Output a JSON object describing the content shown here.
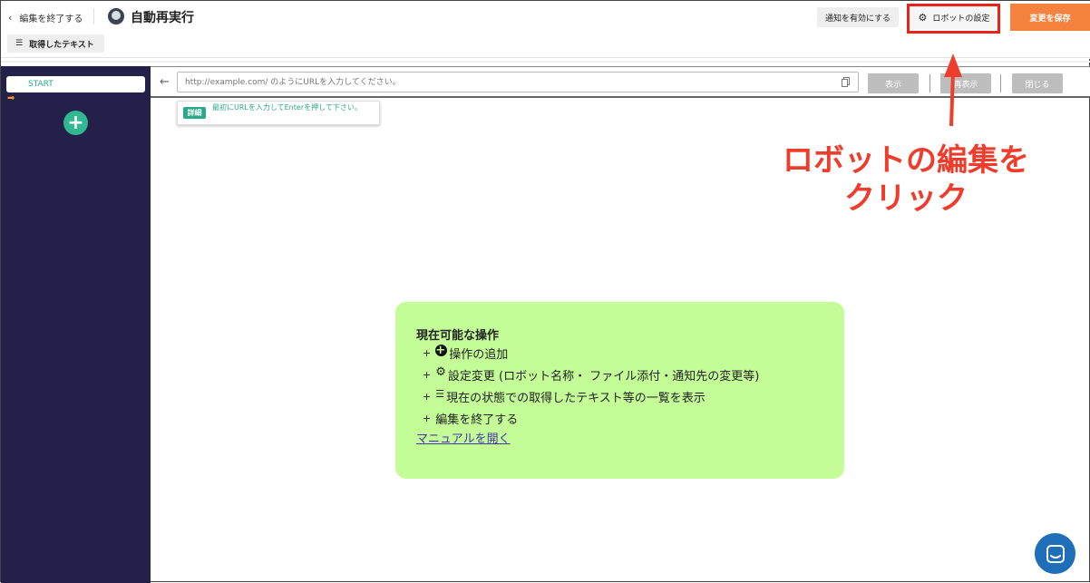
{
  "header": {
    "back_label": "編集を終了する",
    "robot_name": "自動再実行",
    "notify_button": "通知を有効にする",
    "settings_button": "ロボットの設定",
    "save_button": "変更を保存",
    "captured_text_button": "取得したテキスト"
  },
  "sidebar": {
    "start_label": "START"
  },
  "browser": {
    "url_placeholder": "http://example.com/ のようにURLを入力してください。",
    "show_button": "表示",
    "reshow_button": "再表示",
    "close_button": "閉じる",
    "hint_tag": "詳細",
    "hint_text": "最初にURLを入力してEnterを押して下さい。"
  },
  "annotation": {
    "line1": "ロボットの編集を",
    "line2": "クリック",
    "color": "#ee3d2c"
  },
  "info": {
    "title": "現在可能な操作",
    "items": [
      {
        "icon": "plus-circle-icon",
        "text": "操作の追加"
      },
      {
        "icon": "gear-icon",
        "text": "設定変更 (ロボット名称・ ファイル添付・通知先の変更等)"
      },
      {
        "icon": "list-icon",
        "text": "現在の状態での取得したテキスト等の一覧を表示"
      },
      {
        "icon": "",
        "text": "編集を終了する"
      }
    ],
    "link": "マニュアルを開く",
    "bg_color": "#c4fd97"
  },
  "colors": {
    "sidebar": "#23214a",
    "accent_green": "#2aa98a",
    "save_orange": "#f5823f"
  }
}
